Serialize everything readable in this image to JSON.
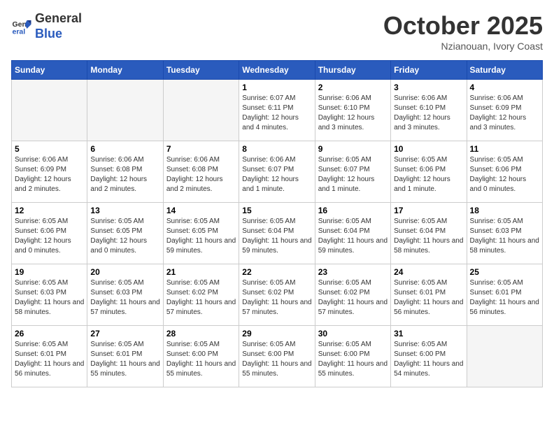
{
  "header": {
    "logo_line1": "General",
    "logo_line2": "Blue",
    "month_title": "October 2025",
    "location": "Nzianouan, Ivory Coast"
  },
  "weekdays": [
    "Sunday",
    "Monday",
    "Tuesday",
    "Wednesday",
    "Thursday",
    "Friday",
    "Saturday"
  ],
  "weeks": [
    [
      {
        "day": "",
        "empty": true
      },
      {
        "day": "",
        "empty": true
      },
      {
        "day": "",
        "empty": true
      },
      {
        "day": "1",
        "sunrise": "6:07 AM",
        "sunset": "6:11 PM",
        "daylight": "12 hours and 4 minutes."
      },
      {
        "day": "2",
        "sunrise": "6:06 AM",
        "sunset": "6:10 PM",
        "daylight": "12 hours and 3 minutes."
      },
      {
        "day": "3",
        "sunrise": "6:06 AM",
        "sunset": "6:10 PM",
        "daylight": "12 hours and 3 minutes."
      },
      {
        "day": "4",
        "sunrise": "6:06 AM",
        "sunset": "6:09 PM",
        "daylight": "12 hours and 3 minutes."
      }
    ],
    [
      {
        "day": "5",
        "sunrise": "6:06 AM",
        "sunset": "6:09 PM",
        "daylight": "12 hours and 2 minutes."
      },
      {
        "day": "6",
        "sunrise": "6:06 AM",
        "sunset": "6:08 PM",
        "daylight": "12 hours and 2 minutes."
      },
      {
        "day": "7",
        "sunrise": "6:06 AM",
        "sunset": "6:08 PM",
        "daylight": "12 hours and 2 minutes."
      },
      {
        "day": "8",
        "sunrise": "6:06 AM",
        "sunset": "6:07 PM",
        "daylight": "12 hours and 1 minute."
      },
      {
        "day": "9",
        "sunrise": "6:05 AM",
        "sunset": "6:07 PM",
        "daylight": "12 hours and 1 minute."
      },
      {
        "day": "10",
        "sunrise": "6:05 AM",
        "sunset": "6:06 PM",
        "daylight": "12 hours and 1 minute."
      },
      {
        "day": "11",
        "sunrise": "6:05 AM",
        "sunset": "6:06 PM",
        "daylight": "12 hours and 0 minutes."
      }
    ],
    [
      {
        "day": "12",
        "sunrise": "6:05 AM",
        "sunset": "6:06 PM",
        "daylight": "12 hours and 0 minutes."
      },
      {
        "day": "13",
        "sunrise": "6:05 AM",
        "sunset": "6:05 PM",
        "daylight": "12 hours and 0 minutes."
      },
      {
        "day": "14",
        "sunrise": "6:05 AM",
        "sunset": "6:05 PM",
        "daylight": "11 hours and 59 minutes."
      },
      {
        "day": "15",
        "sunrise": "6:05 AM",
        "sunset": "6:04 PM",
        "daylight": "11 hours and 59 minutes."
      },
      {
        "day": "16",
        "sunrise": "6:05 AM",
        "sunset": "6:04 PM",
        "daylight": "11 hours and 59 minutes."
      },
      {
        "day": "17",
        "sunrise": "6:05 AM",
        "sunset": "6:04 PM",
        "daylight": "11 hours and 58 minutes."
      },
      {
        "day": "18",
        "sunrise": "6:05 AM",
        "sunset": "6:03 PM",
        "daylight": "11 hours and 58 minutes."
      }
    ],
    [
      {
        "day": "19",
        "sunrise": "6:05 AM",
        "sunset": "6:03 PM",
        "daylight": "11 hours and 58 minutes."
      },
      {
        "day": "20",
        "sunrise": "6:05 AM",
        "sunset": "6:03 PM",
        "daylight": "11 hours and 57 minutes."
      },
      {
        "day": "21",
        "sunrise": "6:05 AM",
        "sunset": "6:02 PM",
        "daylight": "11 hours and 57 minutes."
      },
      {
        "day": "22",
        "sunrise": "6:05 AM",
        "sunset": "6:02 PM",
        "daylight": "11 hours and 57 minutes."
      },
      {
        "day": "23",
        "sunrise": "6:05 AM",
        "sunset": "6:02 PM",
        "daylight": "11 hours and 57 minutes."
      },
      {
        "day": "24",
        "sunrise": "6:05 AM",
        "sunset": "6:01 PM",
        "daylight": "11 hours and 56 minutes."
      },
      {
        "day": "25",
        "sunrise": "6:05 AM",
        "sunset": "6:01 PM",
        "daylight": "11 hours and 56 minutes."
      }
    ],
    [
      {
        "day": "26",
        "sunrise": "6:05 AM",
        "sunset": "6:01 PM",
        "daylight": "11 hours and 56 minutes."
      },
      {
        "day": "27",
        "sunrise": "6:05 AM",
        "sunset": "6:01 PM",
        "daylight": "11 hours and 55 minutes."
      },
      {
        "day": "28",
        "sunrise": "6:05 AM",
        "sunset": "6:00 PM",
        "daylight": "11 hours and 55 minutes."
      },
      {
        "day": "29",
        "sunrise": "6:05 AM",
        "sunset": "6:00 PM",
        "daylight": "11 hours and 55 minutes."
      },
      {
        "day": "30",
        "sunrise": "6:05 AM",
        "sunset": "6:00 PM",
        "daylight": "11 hours and 55 minutes."
      },
      {
        "day": "31",
        "sunrise": "6:05 AM",
        "sunset": "6:00 PM",
        "daylight": "11 hours and 54 minutes."
      },
      {
        "day": "",
        "empty": true
      }
    ]
  ]
}
